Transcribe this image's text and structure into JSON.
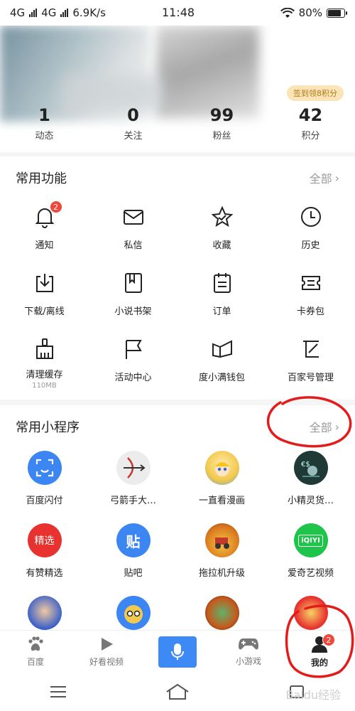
{
  "status": {
    "network1": "4G",
    "network2": "4G",
    "speed": "6.9K/s",
    "time": "11:48",
    "battery": "80%"
  },
  "profile": {
    "signin_badge": "签到领8积分",
    "stats": [
      {
        "value": "1",
        "label": "动态"
      },
      {
        "value": "0",
        "label": "关注"
      },
      {
        "value": "99",
        "label": "粉丝"
      },
      {
        "value": "42",
        "label": "积分"
      }
    ]
  },
  "features": {
    "title": "常用功能",
    "more": "全部",
    "items": [
      {
        "label": "通知",
        "icon": "bell-icon",
        "badge": "2"
      },
      {
        "label": "私信",
        "icon": "mail-icon"
      },
      {
        "label": "收藏",
        "icon": "star-icon"
      },
      {
        "label": "历史",
        "icon": "clock-icon"
      },
      {
        "label": "下载/离线",
        "icon": "download-icon"
      },
      {
        "label": "小说书架",
        "icon": "book-icon"
      },
      {
        "label": "订单",
        "icon": "order-icon"
      },
      {
        "label": "卡券包",
        "icon": "ticket-icon"
      },
      {
        "label": "清理缓存",
        "icon": "broom-icon",
        "sub": "110MB"
      },
      {
        "label": "活动中心",
        "icon": "flag-icon"
      },
      {
        "label": "度小满钱包",
        "icon": "wallet-icon"
      },
      {
        "label": "百家号管理",
        "icon": "edit-icon"
      }
    ]
  },
  "miniprograms": {
    "title": "常用小程序",
    "more": "全部",
    "items": [
      {
        "label": "百度闪付",
        "icon": "scan-pay-icon",
        "color": "#3b86f2"
      },
      {
        "label": "弓箭手大…",
        "icon": "archer-icon",
        "color": "#e8e8e8"
      },
      {
        "label": "一直看漫画",
        "icon": "manga-icon",
        "color": "#f2c94c"
      },
      {
        "label": "小精灵货…",
        "icon": "finance-icon",
        "color": "#2c4f4a"
      },
      {
        "label": "有赞精选",
        "icon": "youzan-icon",
        "color": "#e8322f",
        "text": "精选"
      },
      {
        "label": "贴吧",
        "icon": "tieba-icon",
        "color": "#3b86f2",
        "text": "贴"
      },
      {
        "label": "拖拉机升级",
        "icon": "tractor-icon",
        "color": "#e89a2a"
      },
      {
        "label": "爱奇艺视频",
        "icon": "iqiyi-icon",
        "color": "#1fc44a",
        "text": "iQIYI"
      }
    ],
    "partial_row_colors": [
      "#3a5fc9",
      "#f2c94c",
      "#c65a1e",
      "#e8322f"
    ]
  },
  "tabbar": {
    "items": [
      {
        "label": "百度",
        "icon": "paw-icon"
      },
      {
        "label": "好看视频",
        "icon": "play-icon"
      },
      {
        "label": "",
        "icon": "microphone-icon"
      },
      {
        "label": "小游戏",
        "icon": "gamepad-icon"
      },
      {
        "label": "我的",
        "icon": "user-icon",
        "badge": "2",
        "active": true
      }
    ]
  },
  "watermark": "Baidu经验"
}
